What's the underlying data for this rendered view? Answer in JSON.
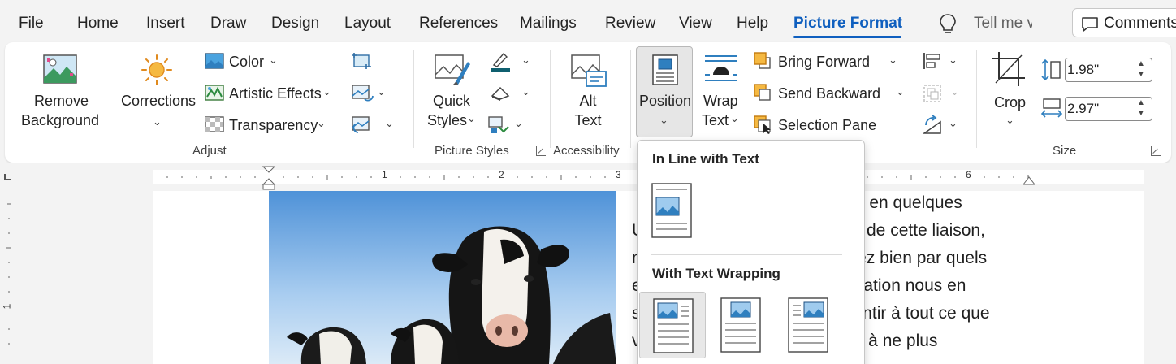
{
  "menu": {
    "tabs": [
      "File",
      "Home",
      "Insert",
      "Draw",
      "Design",
      "Layout",
      "References",
      "Mailings",
      "Review",
      "View",
      "Help",
      "Picture Format"
    ],
    "active_tab": "Picture Format",
    "tell_me": "Tell me v",
    "comments_label": "Comments"
  },
  "ribbon": {
    "remove_background": {
      "line1": "Remove",
      "line2": "Background"
    },
    "corrections": "Corrections",
    "color": "Color",
    "artistic_effects": "Artistic Effects",
    "transparency": "Transparency",
    "adjust_label": "Adjust",
    "quick_styles": {
      "line1": "Quick",
      "line2": "Styles"
    },
    "picture_styles_label": "Picture Styles",
    "alt_text": {
      "line1": "Alt",
      "line2": "Text"
    },
    "accessibility_label": "Accessibility",
    "position": "Position",
    "wrap_text": {
      "line1": "Wrap",
      "line2": "Text"
    },
    "bring_forward": "Bring Forward",
    "send_backward": "Send Backward",
    "selection_pane": "Selection Pane",
    "crop": "Crop",
    "height_value": "1.98\"",
    "width_value": "2.97\"",
    "size_label": "Size"
  },
  "ruler": {
    "numbers": [
      "1",
      "2",
      "3",
      "6"
    ]
  },
  "vertical_ruler": {
    "number": "1"
  },
  "document": {
    "lines": [
      "ter en quelques",
      "de cette liaison,",
      "siez bien par quels",
      "adation nous en",
      "sentir à tout ce que",
      "te, à ne plus"
    ],
    "left_chars": [
      "U",
      "n",
      "e",
      "s",
      "v"
    ]
  },
  "position_menu": {
    "inline_heading": "In Line with Text",
    "wrapping_heading": "With Text Wrapping"
  },
  "colors": {
    "accent": "#0f5fbf",
    "ribbon_bg": "#ffffff",
    "app_bg": "#f3f3f3"
  }
}
